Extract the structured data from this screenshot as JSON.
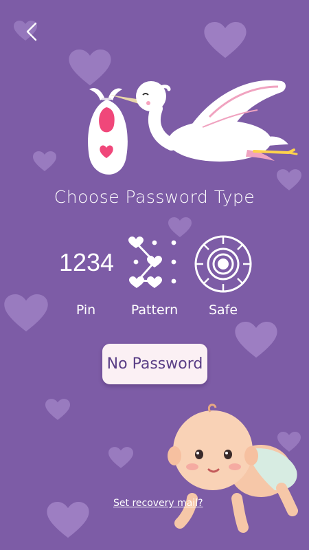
{
  "screen": {
    "title": "Choose Password Type",
    "background_color": "#7d5ca6"
  },
  "back": {
    "icon": "chevron-left-icon"
  },
  "options": {
    "pin": {
      "display": "1234",
      "label": "Pin"
    },
    "pattern": {
      "label": "Pattern",
      "icon": "pattern-hearts-icon"
    },
    "safe": {
      "label": "Safe",
      "icon": "safe-dial-icon"
    }
  },
  "no_password_button": {
    "label": "No Password",
    "background": "#fbf0f4",
    "text_color": "#5a3e86"
  },
  "recovery_link": {
    "label": "Set recovery mail?"
  },
  "decor": {
    "stork_icon": "stork-icon",
    "baby_icon": "baby-icon",
    "heart_color": "#9a7fc0",
    "accent_pink": "#f0477a"
  }
}
